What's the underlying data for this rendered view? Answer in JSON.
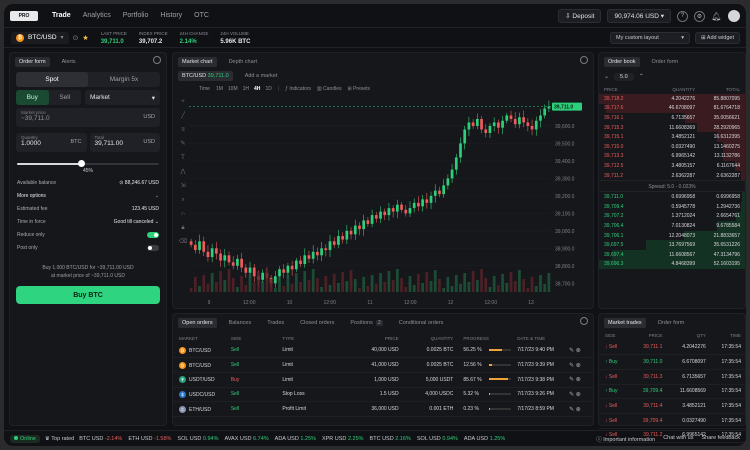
{
  "nav": {
    "logo": "PRO",
    "items": [
      "Trade",
      "Analytics",
      "Portfolio",
      "History",
      "OTC"
    ],
    "active": "Trade"
  },
  "top_right": {
    "deposit": "Deposit",
    "balance": "90,974.06 USD"
  },
  "ticker": {
    "pair": "BTC/USD",
    "stats": [
      {
        "label": "LAST PRICE",
        "value": "39,711.0",
        "green": true
      },
      {
        "label": "INDEX PRICE",
        "value": "39,707.2",
        "green": false
      },
      {
        "label": "24H CHANGE",
        "value": "2.14%",
        "green": true
      },
      {
        "label": "24H VOLUME",
        "value": "5.96K BTC",
        "green": false
      }
    ],
    "layout_select": "My custom layout",
    "add_widget": "Add widget"
  },
  "order_form": {
    "tabs": [
      "Order form",
      "Alerts"
    ],
    "mode_tabs": [
      "Spot",
      "Margin 5x"
    ],
    "side_tabs": [
      "Buy",
      "Sell"
    ],
    "order_type": "Market",
    "price_label": "Market price",
    "price_value": "~39,711.0",
    "price_currency": "USD",
    "quantity_label": "Quantity",
    "quantity_value": "1.0000",
    "quantity_currency": "BTC",
    "total_label": "Total",
    "total_value": "39,711.00",
    "total_currency": "USD",
    "slider_pct": "45%",
    "slider_value": 0.45,
    "available_label": "Available balance",
    "available_value": "88,246.67 USD",
    "more_options": "More options",
    "fee_label": "Estimated fee",
    "fee_value": "123.45 USD",
    "tif_label": "Time in force",
    "tif_value": "Good till canceled",
    "reduce_label": "Reduce only",
    "post_label": "Post only",
    "summary_line1": "Buy 1.000 BTC/USD for ~39,711.00 USD",
    "summary_line2": "at market price of ~39,711.0 USD",
    "buy_button": "Buy BTC"
  },
  "chart_panel": {
    "tabs": [
      "Market chart",
      "Depth chart"
    ],
    "pair_tab": "BTC/USD",
    "pair_price": "39,711.0",
    "add_market": "Add a market",
    "time_label": "Time",
    "timeframes": [
      "1M",
      "10M",
      "1H",
      "4H",
      "1D"
    ],
    "active_tf": "4H",
    "tools": [
      "Indicators",
      "Candles",
      "Presets"
    ],
    "price_tag": "39,711.0"
  },
  "chart_data": {
    "type": "candlestick",
    "xlabels": [
      "9",
      "12:00",
      "10",
      "12:00",
      "11",
      "12:00",
      "12",
      "12:00",
      "13"
    ],
    "ylabels": [
      "39,700.0",
      "39,600.0",
      "39,500.0",
      "39,400.0",
      "39,300.0",
      "39,200.0",
      "39,100.0",
      "39,000.0",
      "38,900.0",
      "38,800.0",
      "38,700.0"
    ],
    "ylim": [
      38650,
      39760
    ],
    "closes": [
      38920,
      38890,
      38940,
      38880,
      38850,
      38900,
      38870,
      38830,
      38860,
      38820,
      38800,
      38840,
      38790,
      38760,
      38790,
      38740,
      38720,
      38760,
      38730,
      38700,
      38740,
      38780,
      38760,
      38800,
      38780,
      38830,
      38810,
      38860,
      38840,
      38880,
      38860,
      38900,
      38890,
      38940,
      38920,
      38970,
      38950,
      39000,
      38980,
      39030,
      39010,
      39060,
      39040,
      39090,
      39070,
      39110,
      39090,
      39130,
      39110,
      39150,
      39120,
      39100,
      39130,
      39160,
      39140,
      39180,
      39160,
      39200,
      39230,
      39210,
      39260,
      39300,
      39350,
      39420,
      39500,
      39580,
      39620,
      39600,
      39640,
      39580,
      39560,
      39600,
      39620,
      39590,
      39630,
      39660,
      39640,
      39610,
      39650,
      39620,
      39600,
      39580,
      39630,
      39660,
      39700,
      39711
    ]
  },
  "order_book": {
    "tabs": [
      "Order book",
      "Order form"
    ],
    "step": "5.0",
    "headers": [
      "PRICE",
      "QUANTITY",
      "TOTAL"
    ],
    "asks": [
      [
        "39,718.2",
        "4.2042276",
        "85.8807095"
      ],
      [
        "39,717.6",
        "46.6708097",
        "81.6764718"
      ],
      [
        "39,716.1",
        "6.7135657",
        "35.0056621"
      ],
      [
        "39,715.3",
        "11.6608369",
        "28.2920965"
      ],
      [
        "39,715.1",
        "3.4852121",
        "16.6312395"
      ],
      [
        "39,715.0",
        "0.0327490",
        "13.1460275"
      ],
      [
        "39,713.3",
        "6.9965142",
        "13.1132786"
      ],
      [
        "39,712.5",
        "3.4805157",
        "6.1167644"
      ],
      [
        "39,711.2",
        "2.6362287",
        "2.6362287"
      ]
    ],
    "ask_depth": [
      1.0,
      0.95,
      0.41,
      0.33,
      0.19,
      0.15,
      0.15,
      0.07,
      0.03
    ],
    "spread": "Spread: 5.0 - 0.023%",
    "bids": [
      [
        "39,711.0",
        "0.6996958",
        "0.6996958"
      ],
      [
        "39,709.4",
        "0.5945778",
        "1.2942736"
      ],
      [
        "39,707.2",
        "1.3712024",
        "2.6654761"
      ],
      [
        "39,706.4",
        "7.0130824",
        "9.6785584"
      ],
      [
        "39,706.1",
        "12.2048073",
        "21.8833657"
      ],
      [
        "39,697.5",
        "13.7697569",
        "35.6531226"
      ],
      [
        "39,697.4",
        "11.6608567",
        "47.3134796"
      ],
      [
        "39,696.3",
        "4.8468399",
        "52.1603195"
      ]
    ],
    "bid_depth": [
      0.02,
      0.03,
      0.06,
      0.19,
      0.42,
      0.68,
      0.91,
      1.0
    ]
  },
  "orders_panel": {
    "tabs": [
      "Open orders",
      "Balances",
      "Trades",
      "Closed orders",
      "Positions",
      "Conditional orders"
    ],
    "positions_badge": "2",
    "headers": [
      "MARKET",
      "SIDE",
      "TYPE",
      "PRICE",
      "QUANTITY",
      "PROGRESS",
      "DATE & TIME"
    ],
    "rows": [
      {
        "market": "BTC/USD",
        "side": "Sell",
        "type": "Limit",
        "price": "40,000 USD",
        "qty": "0.0025 BTC",
        "progress": "56.25 %",
        "pct": 0.56,
        "time": "7/17/23 9:40 PM",
        "coin": "₿",
        "coinColor": "#f7931a"
      },
      {
        "market": "BTC/USD",
        "side": "Sell",
        "type": "Limit",
        "price": "41,000 USD",
        "qty": "0.0025 BTC",
        "progress": "12.56 %",
        "pct": 0.13,
        "time": "7/17/23 9:39 PM",
        "coin": "₿",
        "coinColor": "#f7931a"
      },
      {
        "market": "USDT/USD",
        "side": "Buy",
        "type": "Limit",
        "price": "1,000 USD",
        "qty": "5,000 USDT",
        "progress": "85.67 %",
        "pct": 0.86,
        "time": "7/17/23 9:38 PM",
        "coin": "₮",
        "coinColor": "#26a17b"
      },
      {
        "market": "USDC/USD",
        "side": "Sell",
        "type": "Stop Loss",
        "price": "1.5 USD",
        "qty": "4,000 USDC",
        "progress": "5.32 %",
        "pct": 0.05,
        "time": "7/17/23 9:26 PM",
        "coin": "$",
        "coinColor": "#2775ca"
      },
      {
        "market": "ETH/USD",
        "side": "Sell",
        "type": "Profit Limit",
        "price": "36,000 USD",
        "qty": "0.001 ETH",
        "progress": "0.23 %",
        "pct": 0.01,
        "time": "7/17/23 8:59 PM",
        "coin": "Ξ",
        "coinColor": "#8a92b2"
      }
    ]
  },
  "market_trades": {
    "tabs": [
      "Market trades",
      "Order form"
    ],
    "headers": [
      "SIDE",
      "PRICE",
      "QTY",
      "TIME"
    ],
    "rows": [
      [
        "Sell",
        "39,711.1",
        "4.2042276",
        "17:35:54"
      ],
      [
        "Buy",
        "39,711.0",
        "6.6708097",
        "17:35:54"
      ],
      [
        "Sell",
        "39,711.3",
        "6.7135657",
        "17:35:54"
      ],
      [
        "Buy",
        "39,709.4",
        "11.6608569",
        "17:35:54"
      ],
      [
        "Sell",
        "39,711.4",
        "3.4852121",
        "17:35:54"
      ],
      [
        "Sell",
        "39,709.4",
        "0.0327490",
        "17:35:54"
      ],
      [
        "Sell",
        "39,711.2",
        "6.9965142",
        "17:35:54"
      ]
    ]
  },
  "footer": {
    "online": "Online",
    "top_rated": "Top rated",
    "tickers": [
      {
        "s": "BTC USD",
        "c": "-2.14%",
        "up": false
      },
      {
        "s": "ETH USD",
        "c": "-1.58%",
        "up": false
      },
      {
        "s": "SOL USD",
        "c": "0.94%",
        "up": true
      },
      {
        "s": "AVAX USD",
        "c": "6.74%",
        "up": true
      },
      {
        "s": "ADA USD",
        "c": "1.25%",
        "up": true
      },
      {
        "s": "XPR USD",
        "c": "2.25%",
        "up": true
      },
      {
        "s": "BTC USD",
        "c": "2.16%",
        "up": true
      },
      {
        "s": "SOL USD",
        "c": "0.94%",
        "up": true
      },
      {
        "s": "ADA USD",
        "c": "1.25%",
        "up": true
      }
    ],
    "important": "Important information",
    "chat": "Chat with us",
    "feedback": "Share feedback"
  }
}
